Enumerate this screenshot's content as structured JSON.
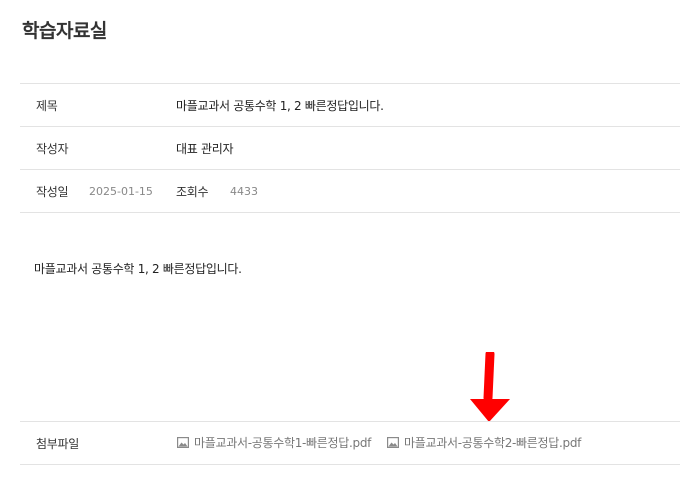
{
  "page": {
    "title": "학습자료실"
  },
  "post": {
    "title_label": "제목",
    "title_value": "마플교과서 공통수학 1, 2 빠른정답입니다.",
    "author_label": "작성자",
    "author_value": "대표 관리자",
    "date_label": "작성일",
    "date_value": "2025-01-15",
    "views_label": "조회수",
    "views_value": "4433",
    "content": "마플교과서 공통수학 1, 2 빠른정답입니다."
  },
  "attachments": {
    "label": "첨부파일",
    "files": [
      {
        "name": "마플교과서-공통수학1-빠른정답.pdf",
        "icon": "image-icon"
      },
      {
        "name": "마플교과서-공통수학2-빠른정답.pdf",
        "icon": "image-icon"
      }
    ]
  },
  "annotation": {
    "icon": "down-arrow-icon",
    "color": "#ff0000"
  }
}
